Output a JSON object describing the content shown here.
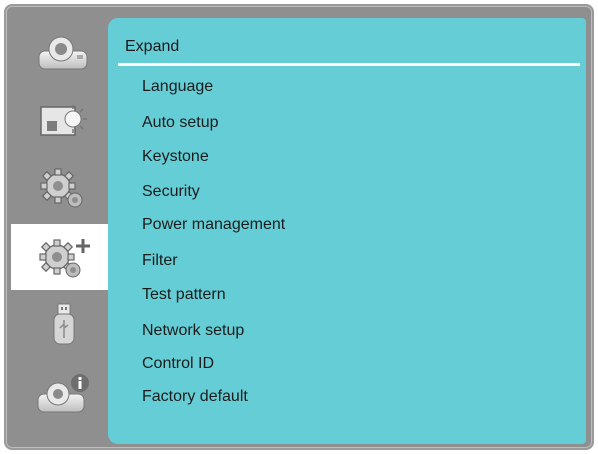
{
  "sidebar": {
    "items": [
      {
        "icon": "projector-icon"
      },
      {
        "icon": "picture-icon"
      },
      {
        "icon": "gear-icon"
      },
      {
        "icon": "gear-plus-icon",
        "selected": true
      },
      {
        "icon": "usb-icon"
      },
      {
        "icon": "projector-info-icon"
      }
    ]
  },
  "panel": {
    "title": "Expand",
    "items": [
      "Language",
      "Auto setup",
      "Keystone",
      "Security",
      "Power management",
      "Filter",
      "Test pattern",
      "Network setup",
      "Control ID",
      "Factory default"
    ]
  },
  "colors": {
    "panel": "#64cdd5",
    "frame": "#8f8f8f",
    "selected_tab": "#ffffff"
  }
}
